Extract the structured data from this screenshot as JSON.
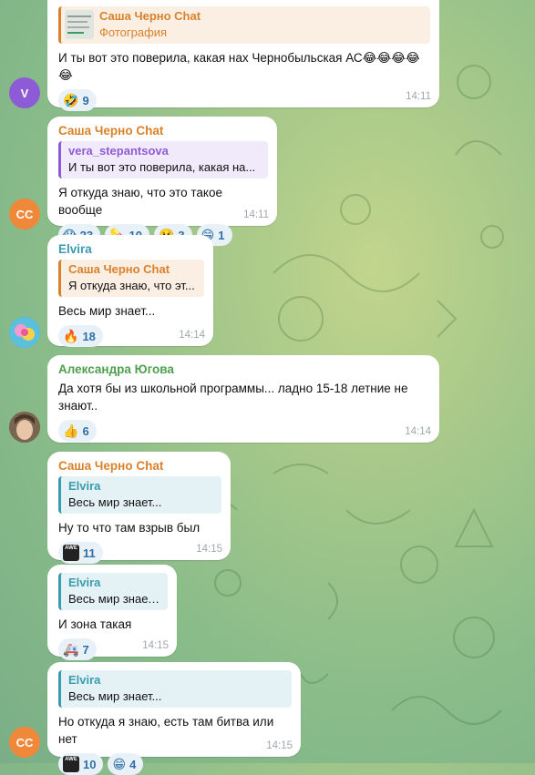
{
  "colors": {
    "orange_name": "#d9822b",
    "purple_name": "#8e5bd6",
    "teal_name": "#3a9bb0",
    "green_name": "#4ea04f",
    "reaction_bg": "#e8f1f8",
    "reply_orange_bg": "#fbeee3",
    "reply_purple_bg": "#f1eafb",
    "reply_teal_bg": "#e5f2f5"
  },
  "messages": [
    {
      "id": "m1",
      "sender": "",
      "reply": {
        "name": "Саша Черно Chat",
        "text": "Фотография",
        "has_thumb": true
      },
      "text": "И ты вот это поверила, какая нах Чернобыльская АС😂😂😂😂😂",
      "reactions": [
        {
          "icon": "rofl-emoji",
          "emoji": "🤣",
          "count": "9"
        }
      ],
      "time": "14:11",
      "avatar": {
        "initials": "V",
        "color": "#8e5bd6"
      }
    },
    {
      "id": "m2",
      "sender": "Саша Черно Chat",
      "reply": {
        "name": "vera_stepantsova",
        "text": "И ты вот это поверила, какая на..."
      },
      "text": "Я откуда знаю, что это такое вообще",
      "reactions": [
        {
          "icon": "scream-emoji",
          "emoji": "😱",
          "count": "23"
        },
        {
          "icon": "pill-emoji",
          "emoji": "💊",
          "count": "10"
        },
        {
          "icon": "woozy-emoji",
          "emoji": "🥴",
          "count": "3"
        },
        {
          "icon": "grin-emoji",
          "emoji": "😁",
          "count": "1"
        }
      ],
      "time": "14:11",
      "avatar": {
        "initials": "СС",
        "color": "#f0883a"
      }
    },
    {
      "id": "m3",
      "sender": "Elvira",
      "reply": {
        "name": "Саша Черно Chat",
        "text": "Я откуда знаю, что эт..."
      },
      "text": "Весь мир знает...",
      "reactions": [
        {
          "icon": "fire-emoji",
          "emoji": "🔥",
          "count": "18"
        }
      ],
      "time": "14:14",
      "avatar": {
        "initials": "",
        "color": "#3aa6c9"
      }
    },
    {
      "id": "m4",
      "sender": "Александра Югова",
      "reply": null,
      "text": "Да хотя бы из школьной программы... ладно 15-18 летние не знают..",
      "reactions": [
        {
          "icon": "thumbs-up-emoji",
          "emoji": "👍",
          "count": "6"
        }
      ],
      "time": "14:14",
      "avatar": {
        "initials": "",
        "color": "#6d5a48"
      }
    },
    {
      "id": "m5",
      "sender": "Саша Черно Chat",
      "reply": {
        "name": "Elvira",
        "text": "Весь мир знает..."
      },
      "text": "Ну то что там взрыв был",
      "reactions": [
        {
          "icon": "awe-sticker-emoji",
          "emoji": "AWE",
          "count": "11"
        }
      ],
      "time": "14:15"
    },
    {
      "id": "m6",
      "sender": "",
      "reply": {
        "name": "Elvira",
        "text": "Весь мир знает..."
      },
      "text": "И зона такая",
      "reactions": [
        {
          "icon": "ambulance-emoji",
          "emoji": "🚑",
          "count": "7"
        }
      ],
      "time": "14:15"
    },
    {
      "id": "m7",
      "sender": "",
      "reply": {
        "name": "Elvira",
        "text": "Весь мир знает..."
      },
      "text": "Но откуда я знаю, есть там битва или нет",
      "reactions": [
        {
          "icon": "awe-sticker-emoji",
          "emoji": "AWE",
          "count": "10"
        },
        {
          "icon": "grin-emoji",
          "emoji": "😁",
          "count": "4"
        }
      ],
      "time": "14:15",
      "avatar": {
        "initials": "СС",
        "color": "#f0883a"
      }
    }
  ]
}
